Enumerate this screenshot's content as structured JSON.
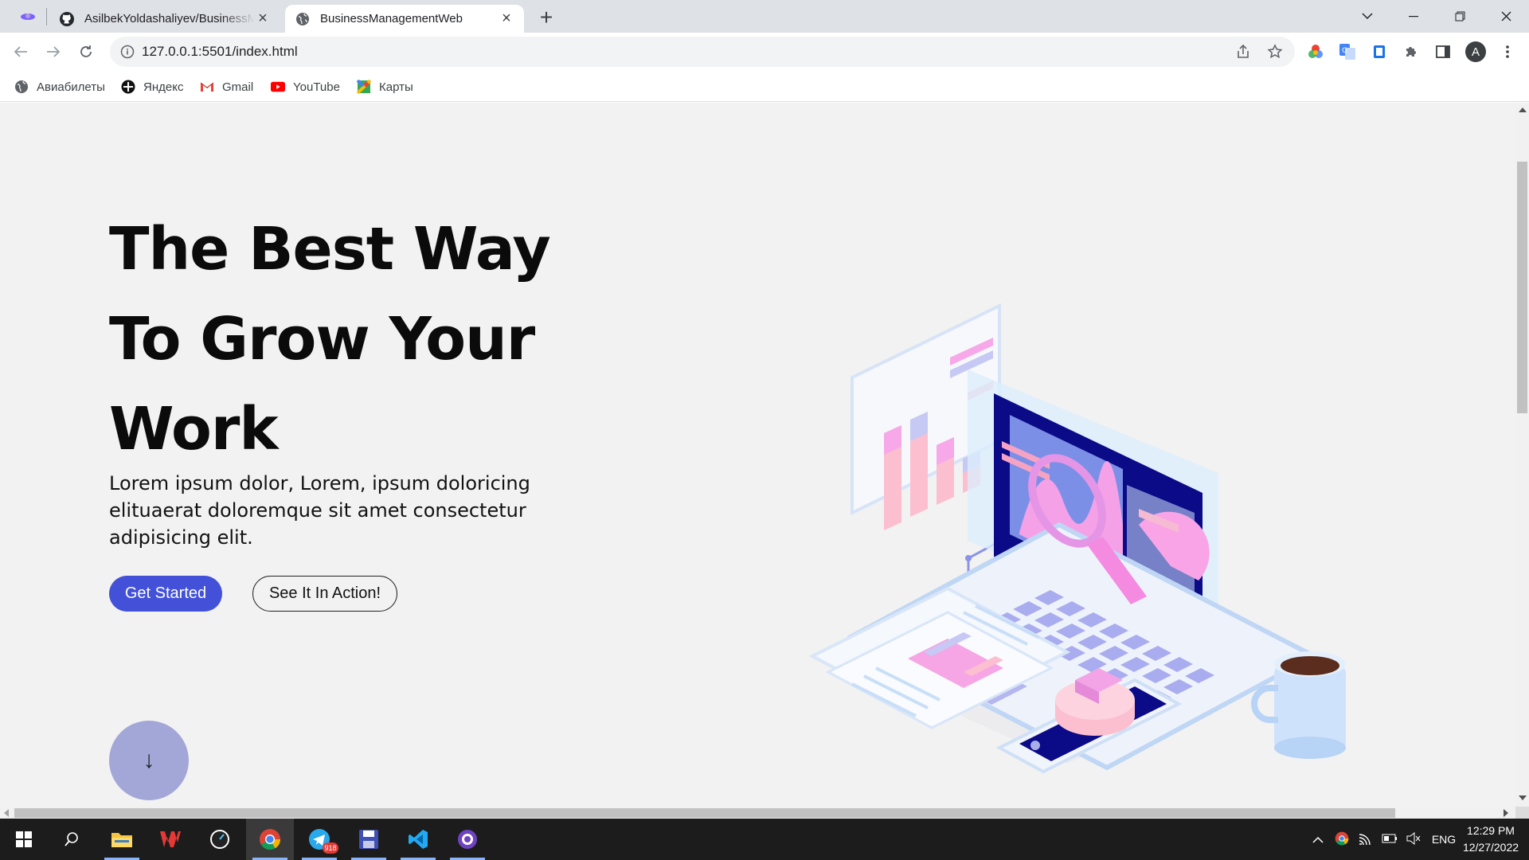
{
  "browser": {
    "tabs": [
      {
        "title": "AsilbekYoldashaliyev/BusinessMa",
        "favicon": "github-icon",
        "active": false
      },
      {
        "title": "BusinessManagementWeb",
        "favicon": "globe-icon",
        "active": true
      }
    ],
    "url": "127.0.0.1:5501/index.html",
    "profile_initial": "A",
    "bookmarks": [
      {
        "label": "Авиабилеты",
        "icon": "globe-icon"
      },
      {
        "label": "Яндекс",
        "icon": "yandex-icon"
      },
      {
        "label": "Gmail",
        "icon": "gmail-icon"
      },
      {
        "label": "YouTube",
        "icon": "youtube-icon"
      },
      {
        "label": "Карты",
        "icon": "maps-icon"
      }
    ]
  },
  "page": {
    "hero": {
      "title_lines": [
        "The Best Way",
        "To Grow Your",
        "Work"
      ],
      "subtitle": "Lorem ipsum dolor, Lorem, ipsum doloricing elituaerat doloremque sit amet consectetur adipisicing elit.",
      "primary_button": "Get Started",
      "secondary_button": "See It In Action!",
      "scroll_arrow": "↓"
    },
    "colors": {
      "accent": "#4351d8",
      "scroll_button": "#a3a7d8",
      "background": "#f2f2f2"
    }
  },
  "taskbar": {
    "apps": [
      "windows-start-icon",
      "search-icon",
      "file-explorer-icon",
      "wps-office-icon",
      "speedometer-icon",
      "chrome-icon",
      "telegram-icon",
      "save-icon",
      "vscode-icon",
      "github-desktop-icon"
    ],
    "telegram_badge": "918",
    "language": "ENG",
    "time": "12:29 PM",
    "date": "12/27/2022"
  }
}
